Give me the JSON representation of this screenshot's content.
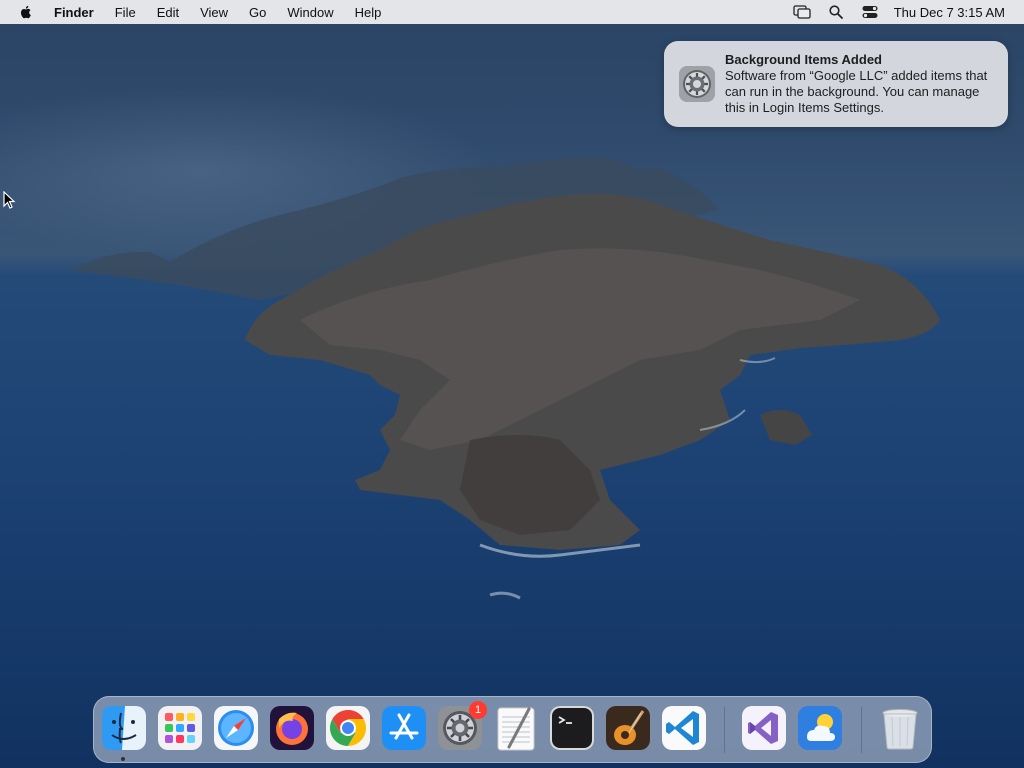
{
  "menubar": {
    "app_name": "Finder",
    "items": [
      "File",
      "Edit",
      "View",
      "Go",
      "Window",
      "Help"
    ],
    "clock": "Thu Dec 7  3:15 AM"
  },
  "notification": {
    "title": "Background Items Added",
    "body": "Software from “Google LLC” added items that can run in the background. You can manage this in Login Items Settings.",
    "icon": "system-settings-gear-icon"
  },
  "dock": {
    "apps": [
      {
        "name": "finder-icon"
      },
      {
        "name": "launchpad-icon"
      },
      {
        "name": "safari-icon"
      },
      {
        "name": "firefox-icon"
      },
      {
        "name": "chrome-icon"
      },
      {
        "name": "app-store-icon"
      },
      {
        "name": "system-settings-icon",
        "badge": "1"
      },
      {
        "name": "textedit-icon"
      },
      {
        "name": "terminal-icon"
      },
      {
        "name": "garageband-icon"
      },
      {
        "name": "vscode-icon"
      },
      {
        "name": "visual-studio-icon"
      },
      {
        "name": "weather-icon"
      },
      {
        "name": "trash-icon"
      }
    ]
  }
}
